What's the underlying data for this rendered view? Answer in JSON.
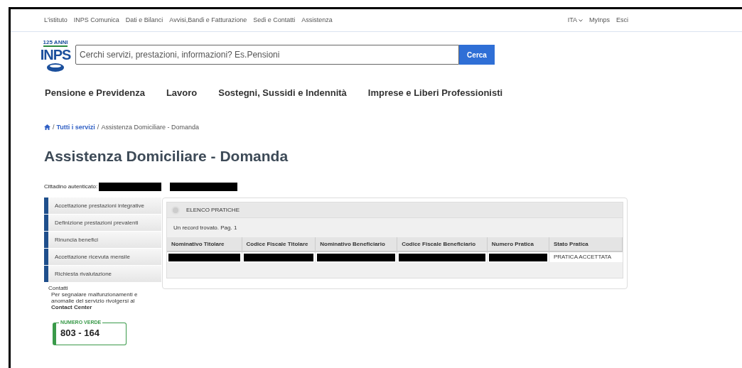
{
  "top_links": [
    "L'istituto",
    "INPS Comunica",
    "Dati e Bilanci",
    "Avvisi,Bandi e Fatturazione",
    "Sedi e Contatti",
    "Assistenza"
  ],
  "top_right": {
    "language": "ITA",
    "links": [
      "MyInps",
      "Esci"
    ]
  },
  "logo": {
    "caption": "125 ANNI",
    "name": "INPS"
  },
  "search": {
    "placeholder": "Cerchi servizi, prestazioni, informazioni? Es.Pensioni",
    "button": "Cerca"
  },
  "main_nav": [
    "Pensione e Previdenza",
    "Lavoro",
    "Sostegni, Sussidi e Indennità",
    "Imprese e Liberi Professionisti"
  ],
  "breadcrumb": {
    "separator": "/",
    "link": "Tutti i servizi",
    "current": "Assistenza Domiciliare - Domanda"
  },
  "page_title": "Assistenza Domiciliare - Domanda",
  "user_label": "Cittadino autenticato:",
  "sidebar": {
    "items": [
      "Accettazione prestazioni integrative",
      "Definizione prestazioni prevalenti",
      "Rinuncia benefici",
      "Accettazione ricevuta mensile",
      "Richiesta rivalutazione"
    ]
  },
  "contacts": {
    "title": "Contatti",
    "text": "Per segnalare malfunzionamenti e anomalie del servizio rivolgersi al",
    "center": "Contact Center",
    "badge_label": "NUMERO VERDE",
    "badge_number": "803 - 164"
  },
  "panel": {
    "title": "ELENCO PRATICHE",
    "summary": "Un record trovato. Pag. 1",
    "columns": [
      "Nominativo Titolare",
      "Codice Fiscale Titolare",
      "Nominativo Beneficiario",
      "Codice Fiscale Beneficiario",
      "Numero Pratica",
      "Stato Pratica"
    ],
    "rows": [
      [
        {
          "kind": "redacted"
        },
        {
          "kind": "redacted"
        },
        {
          "kind": "redacted"
        },
        {
          "kind": "redacted"
        },
        {
          "kind": "redacted"
        },
        {
          "kind": "text",
          "text": "PRATICA ACCETTATA"
        }
      ]
    ]
  }
}
